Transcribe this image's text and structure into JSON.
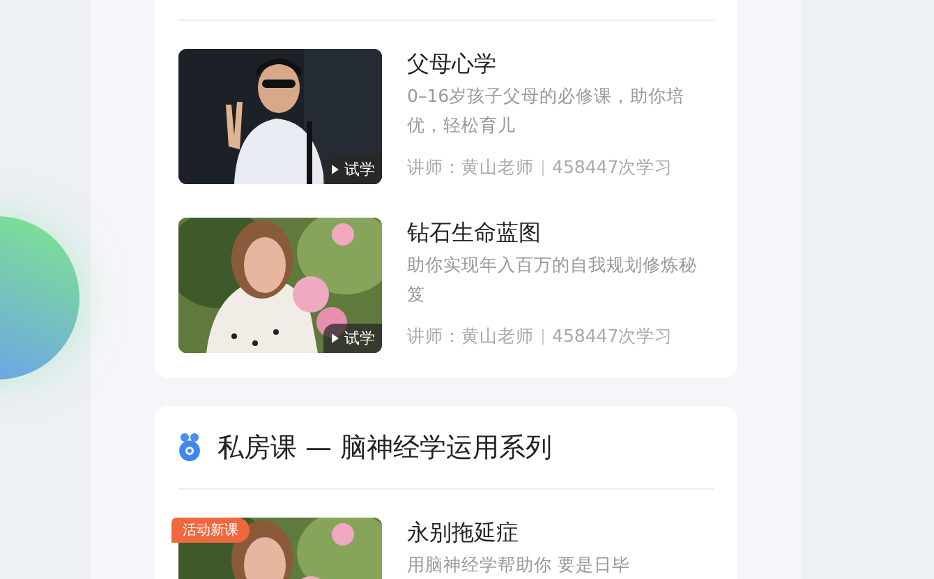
{
  "sections": [
    {
      "courses": [
        {
          "title": "父母心学",
          "description": "0–16岁孩子父母的必修课，助你培优，轻松育儿",
          "teacher": "讲师：黄山老师",
          "count": "458447次学习",
          "trial": "试学",
          "kind": "picture"
        },
        {
          "title": "钻石生命蓝图",
          "description": "助你实现年入百万的自我规划修炼秘笈",
          "teacher": "讲师：黄山老师",
          "count": "458447次学习",
          "trial": "试学",
          "kind": "picture"
        }
      ]
    },
    {
      "title": "私房课 — 脑神经学运用系列",
      "courses": [
        {
          "title": "永别拖延症",
          "description": "用脑神经学帮助你 要是日毕",
          "badge": "活动新课",
          "kind": "picture"
        }
      ]
    }
  ]
}
